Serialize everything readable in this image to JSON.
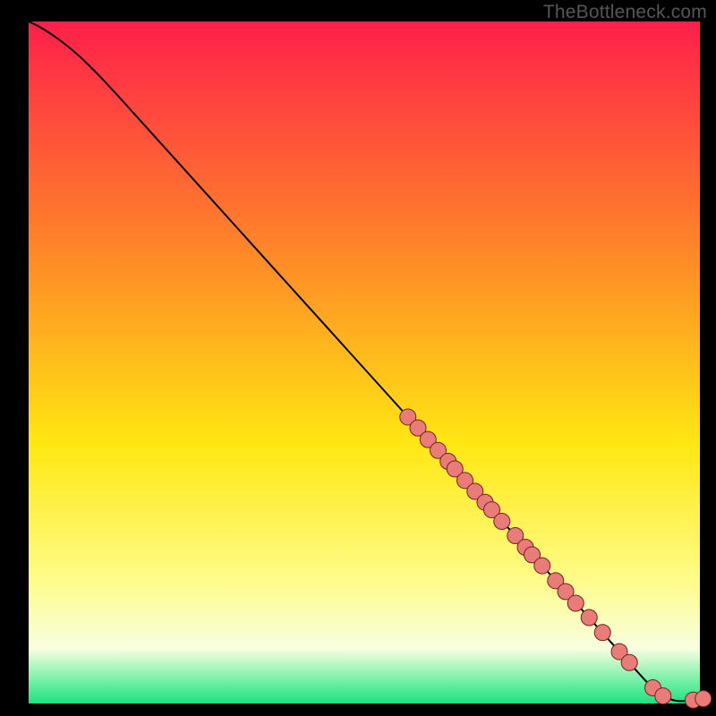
{
  "watermark": "TheBottleneck.com",
  "chart_data": {
    "type": "line",
    "title": "",
    "xlabel": "",
    "ylabel": "",
    "xlim": [
      0,
      100
    ],
    "ylim": [
      0,
      100
    ],
    "colors": {
      "gradient_top": "#ff1f4a",
      "gradient_upper_mid": "#ff8b27",
      "gradient_mid": "#ffe712",
      "gradient_lower_mid": "#fffc8a",
      "gradient_pale": "#f7ffe0",
      "gradient_bottom": "#19e47e",
      "line": "#000000",
      "marker_fill": "#e97c78",
      "marker_stroke": "#732222"
    },
    "curve": [
      {
        "x": 0.0,
        "y": 100.0
      },
      {
        "x": 2.0,
        "y": 99.0
      },
      {
        "x": 5.0,
        "y": 97.0
      },
      {
        "x": 8.0,
        "y": 94.5
      },
      {
        "x": 12.0,
        "y": 90.5
      },
      {
        "x": 20.0,
        "y": 81.8
      },
      {
        "x": 30.0,
        "y": 70.9
      },
      {
        "x": 40.0,
        "y": 60.0
      },
      {
        "x": 50.0,
        "y": 49.1
      },
      {
        "x": 60.0,
        "y": 38.2
      },
      {
        "x": 70.0,
        "y": 27.3
      },
      {
        "x": 80.0,
        "y": 16.4
      },
      {
        "x": 90.0,
        "y": 5.4
      },
      {
        "x": 93.0,
        "y": 2.3
      },
      {
        "x": 95.0,
        "y": 0.9
      },
      {
        "x": 97.0,
        "y": 0.35
      },
      {
        "x": 100.0,
        "y": 0.6
      }
    ],
    "markers": [
      {
        "x": 56.5,
        "y": 42.0
      },
      {
        "x": 58.0,
        "y": 40.4
      },
      {
        "x": 59.5,
        "y": 38.7
      },
      {
        "x": 61.0,
        "y": 37.1
      },
      {
        "x": 62.5,
        "y": 35.5
      },
      {
        "x": 63.5,
        "y": 34.4
      },
      {
        "x": 65.0,
        "y": 32.7
      },
      {
        "x": 66.5,
        "y": 31.1
      },
      {
        "x": 68.0,
        "y": 29.5
      },
      {
        "x": 69.0,
        "y": 28.4
      },
      {
        "x": 70.5,
        "y": 26.7
      },
      {
        "x": 72.5,
        "y": 24.6
      },
      {
        "x": 74.0,
        "y": 22.9
      },
      {
        "x": 75.0,
        "y": 21.8
      },
      {
        "x": 76.5,
        "y": 20.2
      },
      {
        "x": 78.5,
        "y": 18.0
      },
      {
        "x": 80.0,
        "y": 16.4
      },
      {
        "x": 81.5,
        "y": 14.7
      },
      {
        "x": 83.5,
        "y": 12.6
      },
      {
        "x": 85.5,
        "y": 10.4
      },
      {
        "x": 88.0,
        "y": 7.6
      },
      {
        "x": 89.5,
        "y": 6.0
      },
      {
        "x": 93.0,
        "y": 2.3
      },
      {
        "x": 94.5,
        "y": 1.1
      },
      {
        "x": 99.0,
        "y": 0.5
      },
      {
        "x": 100.5,
        "y": 0.7
      }
    ],
    "marker_radius": 1.2
  }
}
